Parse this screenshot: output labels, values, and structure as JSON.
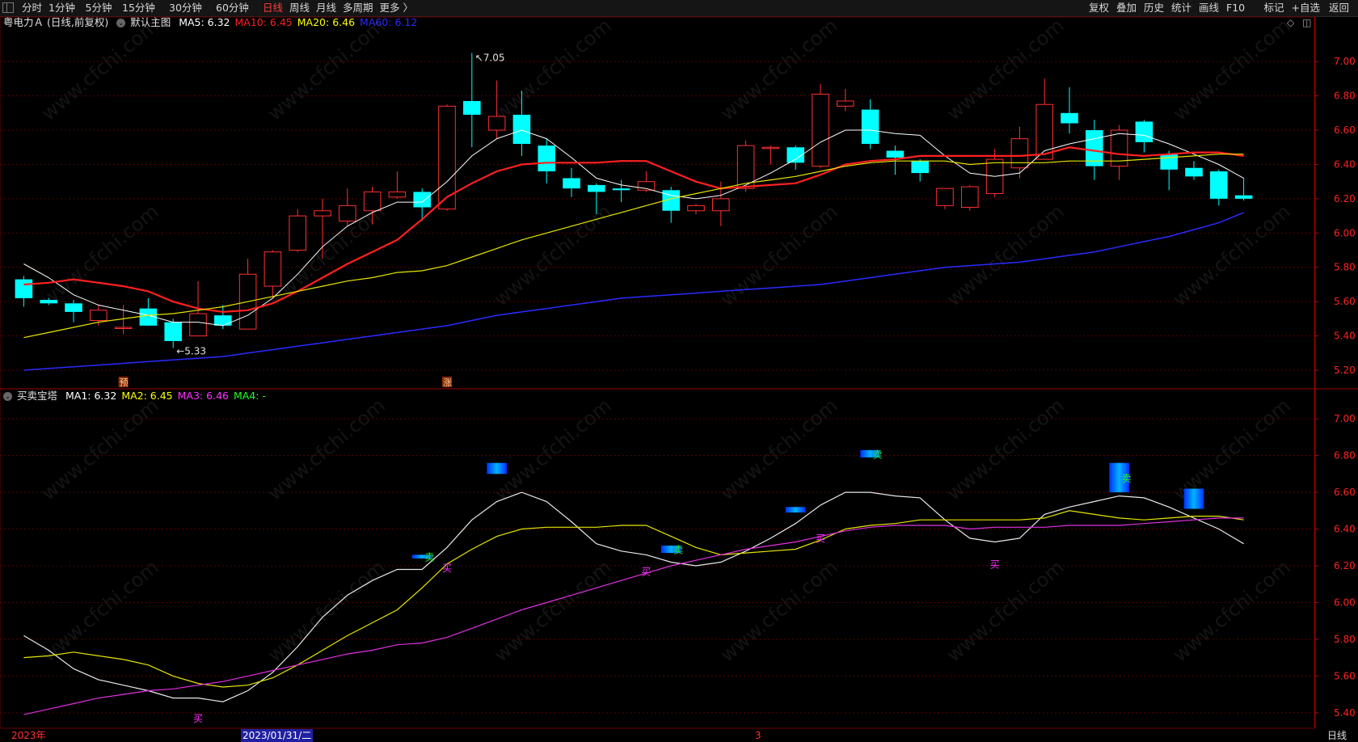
{
  "toolbar": {
    "left_items": [
      "分时",
      "1分钟",
      "5分钟",
      "15分钟",
      "30分钟",
      "60分钟",
      "日线",
      "周线",
      "月线",
      "多周期",
      "更多 〉"
    ],
    "active_item": "日线",
    "right_items": [
      "复权",
      "叠加",
      "历史",
      "统计",
      "画线",
      "F10",
      "标记",
      "+自选",
      "返回"
    ]
  },
  "main_chart": {
    "stock_label": "粤电力Ａ (日线,前复权)",
    "template_label": "默认主图",
    "ma_legend": [
      {
        "label": "MA5: 6.32",
        "color": "#ffffff"
      },
      {
        "label": "MA10: 6.45",
        "color": "#ff2020"
      },
      {
        "label": "MA20: 6.46",
        "color": "#ffff00"
      },
      {
        "label": "MA60: 6.12",
        "color": "#2a2aff"
      }
    ],
    "max_marker": "7.05",
    "min_marker": "5.33",
    "markers": [
      {
        "text": "预",
        "index": 4
      },
      {
        "text": "涨",
        "index": 17
      }
    ],
    "corner_icons": [
      "◇",
      "◫"
    ]
  },
  "sub_chart": {
    "indicator_label": "买卖宝塔",
    "legend": [
      {
        "label": "MA1: 6.32",
        "color": "#ffffff"
      },
      {
        "label": "MA2: 6.45",
        "color": "#ffff00"
      },
      {
        "label": "MA3: 6.46",
        "color": "#ff30ff"
      },
      {
        "label": "MA4: -",
        "color": "#20ff20"
      }
    ],
    "buy_label": "买",
    "sell_label": "卖"
  },
  "status_bar": {
    "year_label": "2023年",
    "cursor_date": "2023/01/31/二",
    "month_label": "3",
    "period_label": "日线"
  },
  "watermark": "www.cfchi.com",
  "colors": {
    "up": "#ff3030",
    "down": "#00ffff",
    "axis": "#ff2020",
    "grid": "#5a0000"
  },
  "chart_data": [
    {
      "type": "candlestick",
      "title": "粤电力Ａ (日线,前复权)",
      "ylim": [
        5.12,
        7.18
      ],
      "yticks": [
        7.0,
        6.8,
        6.6,
        6.4,
        6.2,
        6.0,
        5.8,
        5.6,
        5.4,
        5.2
      ],
      "candles": [
        {
          "o": 5.73,
          "c": 5.62,
          "h": 5.75,
          "l": 5.57
        },
        {
          "o": 5.61,
          "c": 5.59,
          "h": 5.62,
          "l": 5.58
        },
        {
          "o": 5.59,
          "c": 5.54,
          "h": 5.61,
          "l": 5.48
        },
        {
          "o": 5.49,
          "c": 5.55,
          "h": 5.58,
          "l": 5.46
        },
        {
          "o": 5.45,
          "c": 5.45,
          "h": 5.58,
          "l": 5.41
        },
        {
          "o": 5.56,
          "c": 5.46,
          "h": 5.62,
          "l": 5.46
        },
        {
          "o": 5.48,
          "c": 5.37,
          "h": 5.5,
          "l": 5.33
        },
        {
          "o": 5.4,
          "c": 5.53,
          "h": 5.72,
          "l": 5.4
        },
        {
          "o": 5.52,
          "c": 5.46,
          "h": 5.58,
          "l": 5.44
        },
        {
          "o": 5.44,
          "c": 5.76,
          "h": 5.85,
          "l": 5.44
        },
        {
          "o": 5.69,
          "c": 5.89,
          "h": 5.9,
          "l": 5.62
        },
        {
          "o": 5.9,
          "c": 6.1,
          "h": 6.14,
          "l": 5.89
        },
        {
          "o": 6.1,
          "c": 6.13,
          "h": 6.2,
          "l": 5.85
        },
        {
          "o": 6.07,
          "c": 6.16,
          "h": 6.26,
          "l": 6.04
        },
        {
          "o": 6.13,
          "c": 6.24,
          "h": 6.27,
          "l": 6.05
        },
        {
          "o": 6.21,
          "c": 6.24,
          "h": 6.36,
          "l": 6.2
        },
        {
          "o": 6.24,
          "c": 6.15,
          "h": 6.26,
          "l": 6.07
        },
        {
          "o": 6.14,
          "c": 6.74,
          "h": 6.75,
          "l": 6.13
        },
        {
          "o": 6.77,
          "c": 6.69,
          "h": 7.05,
          "l": 6.5
        },
        {
          "o": 6.6,
          "c": 6.68,
          "h": 6.89,
          "l": 6.55
        },
        {
          "o": 6.69,
          "c": 6.52,
          "h": 6.83,
          "l": 6.45
        },
        {
          "o": 6.51,
          "c": 6.36,
          "h": 6.55,
          "l": 6.29
        },
        {
          "o": 6.32,
          "c": 6.26,
          "h": 6.38,
          "l": 6.21
        },
        {
          "o": 6.28,
          "c": 6.24,
          "h": 6.29,
          "l": 6.11
        },
        {
          "o": 6.26,
          "c": 6.25,
          "h": 6.31,
          "l": 6.18
        },
        {
          "o": 6.25,
          "c": 6.3,
          "h": 6.36,
          "l": 6.24
        },
        {
          "o": 6.25,
          "c": 6.13,
          "h": 6.27,
          "l": 6.06
        },
        {
          "o": 6.13,
          "c": 6.16,
          "h": 6.17,
          "l": 6.11
        },
        {
          "o": 6.13,
          "c": 6.2,
          "h": 6.3,
          "l": 6.04
        },
        {
          "o": 6.26,
          "c": 6.51,
          "h": 6.54,
          "l": 6.24
        },
        {
          "o": 6.5,
          "c": 6.5,
          "h": 6.51,
          "l": 6.4
        },
        {
          "o": 6.5,
          "c": 6.41,
          "h": 6.51,
          "l": 6.37
        },
        {
          "o": 6.39,
          "c": 6.81,
          "h": 6.87,
          "l": 6.38
        },
        {
          "o": 6.74,
          "c": 6.77,
          "h": 6.84,
          "l": 6.71
        },
        {
          "o": 6.72,
          "c": 6.52,
          "h": 6.78,
          "l": 6.49
        },
        {
          "o": 6.48,
          "c": 6.44,
          "h": 6.51,
          "l": 6.34
        },
        {
          "o": 6.42,
          "c": 6.35,
          "h": 6.43,
          "l": 6.3
        },
        {
          "o": 6.16,
          "c": 6.26,
          "h": 6.26,
          "l": 6.14
        },
        {
          "o": 6.15,
          "c": 6.27,
          "h": 6.28,
          "l": 6.13
        },
        {
          "o": 6.23,
          "c": 6.43,
          "h": 6.49,
          "l": 6.21
        },
        {
          "o": 6.38,
          "c": 6.55,
          "h": 6.62,
          "l": 6.32
        },
        {
          "o": 6.43,
          "c": 6.75,
          "h": 6.9,
          "l": 6.43
        },
        {
          "o": 6.7,
          "c": 6.64,
          "h": 6.85,
          "l": 6.58
        },
        {
          "o": 6.6,
          "c": 6.39,
          "h": 6.66,
          "l": 6.31
        },
        {
          "o": 6.39,
          "c": 6.6,
          "h": 6.63,
          "l": 6.31
        },
        {
          "o": 6.65,
          "c": 6.53,
          "h": 6.66,
          "l": 6.47
        },
        {
          "o": 6.46,
          "c": 6.37,
          "h": 6.48,
          "l": 6.25
        },
        {
          "o": 6.38,
          "c": 6.33,
          "h": 6.42,
          "l": 6.31
        },
        {
          "o": 6.36,
          "c": 6.2,
          "h": 6.37,
          "l": 6.16
        },
        {
          "o": 6.22,
          "c": 6.2,
          "h": 6.32,
          "l": 6.19
        }
      ],
      "series": [
        {
          "name": "MA5",
          "values": [
            5.82,
            5.74,
            5.64,
            5.58,
            5.55,
            5.52,
            5.48,
            5.48,
            5.46,
            5.52,
            5.62,
            5.76,
            5.92,
            6.04,
            6.12,
            6.18,
            6.18,
            6.3,
            6.45,
            6.55,
            6.6,
            6.55,
            6.44,
            6.32,
            6.28,
            6.26,
            6.22,
            6.2,
            6.22,
            6.28,
            6.35,
            6.43,
            6.53,
            6.6,
            6.6,
            6.58,
            6.57,
            6.45,
            6.35,
            6.33,
            6.35,
            6.48,
            6.52,
            6.55,
            6.58,
            6.57,
            6.52,
            6.46,
            6.4,
            6.32
          ]
        },
        {
          "name": "MA10",
          "values": [
            5.7,
            5.71,
            5.73,
            5.71,
            5.69,
            5.66,
            5.6,
            5.56,
            5.54,
            5.55,
            5.59,
            5.66,
            5.74,
            5.82,
            5.89,
            5.96,
            6.08,
            6.21,
            6.29,
            6.36,
            6.4,
            6.41,
            6.41,
            6.41,
            6.42,
            6.42,
            6.36,
            6.3,
            6.26,
            6.27,
            6.28,
            6.29,
            6.34,
            6.4,
            6.42,
            6.43,
            6.45,
            6.45,
            6.45,
            6.45,
            6.45,
            6.46,
            6.5,
            6.48,
            6.46,
            6.45,
            6.46,
            6.47,
            6.47,
            6.45
          ]
        },
        {
          "name": "MA20",
          "values": [
            5.39,
            5.42,
            5.45,
            5.48,
            5.5,
            5.52,
            5.53,
            5.55,
            5.57,
            5.6,
            5.63,
            5.66,
            5.69,
            5.72,
            5.74,
            5.77,
            5.78,
            5.81,
            5.86,
            5.91,
            5.96,
            6.0,
            6.04,
            6.08,
            6.12,
            6.16,
            6.2,
            6.23,
            6.26,
            6.29,
            6.31,
            6.33,
            6.36,
            6.39,
            6.41,
            6.42,
            6.42,
            6.42,
            6.4,
            6.41,
            6.41,
            6.41,
            6.42,
            6.42,
            6.42,
            6.43,
            6.44,
            6.45,
            6.46,
            6.46
          ]
        },
        {
          "name": "MA60",
          "values": [
            5.2,
            5.21,
            5.22,
            5.23,
            5.24,
            5.25,
            5.26,
            5.27,
            5.28,
            5.3,
            5.32,
            5.34,
            5.36,
            5.38,
            5.4,
            5.42,
            5.44,
            5.46,
            5.49,
            5.52,
            5.54,
            5.56,
            5.58,
            5.6,
            5.62,
            5.63,
            5.64,
            5.65,
            5.66,
            5.67,
            5.68,
            5.69,
            5.7,
            5.72,
            5.74,
            5.76,
            5.78,
            5.8,
            5.81,
            5.82,
            5.83,
            5.85,
            5.87,
            5.89,
            5.92,
            5.95,
            5.98,
            6.02,
            6.06,
            6.12
          ]
        }
      ]
    },
    {
      "type": "line",
      "title": "买卖宝塔",
      "ylim": [
        5.32,
        7.08
      ],
      "yticks": [
        7.0,
        6.8,
        6.6,
        6.4,
        6.2,
        6.0,
        5.8,
        5.6,
        5.4
      ],
      "series": [
        {
          "name": "MA1",
          "values": [
            5.82,
            5.74,
            5.64,
            5.58,
            5.55,
            5.52,
            5.48,
            5.48,
            5.46,
            5.52,
            5.62,
            5.76,
            5.92,
            6.04,
            6.12,
            6.18,
            6.18,
            6.3,
            6.45,
            6.55,
            6.6,
            6.55,
            6.44,
            6.32,
            6.28,
            6.26,
            6.22,
            6.2,
            6.22,
            6.28,
            6.35,
            6.43,
            6.53,
            6.6,
            6.6,
            6.58,
            6.57,
            6.45,
            6.35,
            6.33,
            6.35,
            6.48,
            6.52,
            6.55,
            6.58,
            6.57,
            6.52,
            6.46,
            6.4,
            6.32
          ]
        },
        {
          "name": "MA2",
          "values": [
            5.7,
            5.71,
            5.73,
            5.71,
            5.69,
            5.66,
            5.6,
            5.56,
            5.54,
            5.55,
            5.59,
            5.66,
            5.74,
            5.82,
            5.89,
            5.96,
            6.08,
            6.21,
            6.29,
            6.36,
            6.4,
            6.41,
            6.41,
            6.41,
            6.42,
            6.42,
            6.36,
            6.3,
            6.26,
            6.27,
            6.28,
            6.29,
            6.34,
            6.4,
            6.42,
            6.43,
            6.45,
            6.45,
            6.45,
            6.45,
            6.45,
            6.46,
            6.5,
            6.48,
            6.46,
            6.45,
            6.46,
            6.47,
            6.47,
            6.45
          ]
        },
        {
          "name": "MA3",
          "values": [
            5.39,
            5.42,
            5.45,
            5.48,
            5.5,
            5.52,
            5.53,
            5.55,
            5.57,
            5.6,
            5.63,
            5.66,
            5.69,
            5.72,
            5.74,
            5.77,
            5.78,
            5.81,
            5.86,
            5.91,
            5.96,
            6.0,
            6.04,
            6.08,
            6.12,
            6.16,
            6.2,
            6.23,
            6.26,
            6.29,
            6.31,
            6.33,
            6.36,
            6.39,
            6.41,
            6.42,
            6.42,
            6.42,
            6.4,
            6.41,
            6.41,
            6.41,
            6.42,
            6.42,
            6.42,
            6.43,
            6.44,
            6.45,
            6.46,
            6.46
          ]
        }
      ],
      "towers": [
        {
          "index": 16,
          "lo": 6.24,
          "hi": 6.26,
          "label": "卖"
        },
        {
          "index": 19,
          "lo": 6.7,
          "hi": 6.76,
          "label": ""
        },
        {
          "index": 26,
          "lo": 6.27,
          "hi": 6.31,
          "label": "卖"
        },
        {
          "index": 31,
          "lo": 6.49,
          "hi": 6.52,
          "label": ""
        },
        {
          "index": 34,
          "lo": 6.79,
          "hi": 6.83,
          "label": "卖"
        },
        {
          "index": 44,
          "lo": 6.6,
          "hi": 6.76,
          "label": "卖"
        },
        {
          "index": 47,
          "lo": 6.51,
          "hi": 6.62,
          "label": ""
        }
      ],
      "buy_signals": [
        {
          "index": 7,
          "value": 5.35
        },
        {
          "index": 17,
          "value": 6.17
        },
        {
          "index": 25,
          "value": 6.15
        },
        {
          "index": 32,
          "value": 6.33
        },
        {
          "index": 39,
          "value": 6.19
        }
      ]
    }
  ]
}
